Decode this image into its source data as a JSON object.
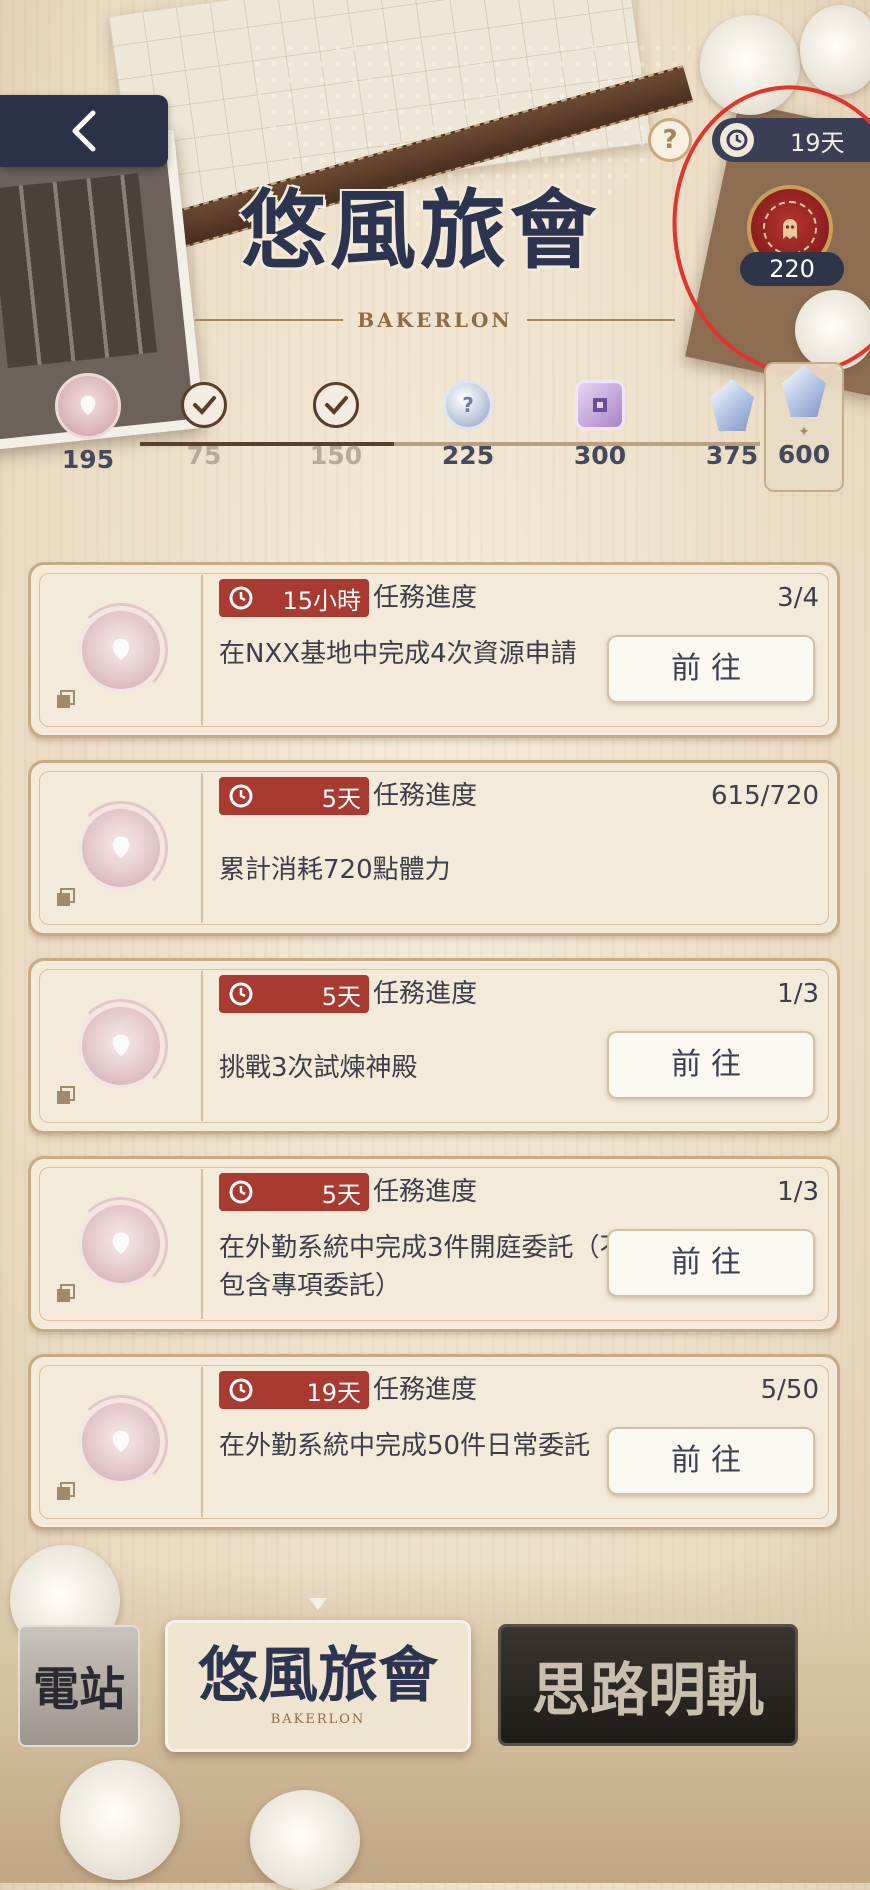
{
  "header": {
    "title": "悠風旅會",
    "subtitle": "BAKERLON",
    "help_label": "?",
    "timer_label": "19天",
    "currency_count": "220"
  },
  "milestones": {
    "current": "195",
    "items": [
      {
        "value": "75",
        "state": "claimed"
      },
      {
        "value": "150",
        "state": "claimed"
      },
      {
        "value": "225",
        "reward": "silver-coin"
      },
      {
        "value": "300",
        "reward": "purple-chip"
      },
      {
        "value": "375",
        "reward": "crystal"
      },
      {
        "value": "600",
        "reward": "crystal"
      }
    ],
    "progress_fraction": 0.41
  },
  "tasks": [
    {
      "timer": "15小時",
      "progress_label": "任務進度",
      "progress": "3/4",
      "desc": "在NXX基地中完成4次資源申請",
      "action": "前往"
    },
    {
      "timer": "5天",
      "progress_label": "任務進度",
      "progress": "615/720",
      "desc": "累計消耗720點體力",
      "action": ""
    },
    {
      "timer": "5天",
      "progress_label": "任務進度",
      "progress": "1/3",
      "desc": "挑戰3次試煉神殿",
      "action": "前往"
    },
    {
      "timer": "5天",
      "progress_label": "任務進度",
      "progress": "1/3",
      "desc": "在外勤系統中完成3件開庭委託（不包含專項委託）",
      "action": "前往"
    },
    {
      "timer": "19天",
      "progress_label": "任務進度",
      "progress": "5/50",
      "desc": "在外勤系統中完成50件日常委託",
      "action": "前往"
    }
  ],
  "bottom_nav": {
    "prev_label": "電站",
    "current_label": "悠風旅會",
    "current_sub": "BAKERLON",
    "next_label": "思路明軌"
  },
  "colors": {
    "accent_red": "#a83a31",
    "navy": "#2c3450",
    "annotation": "#e1342c"
  }
}
